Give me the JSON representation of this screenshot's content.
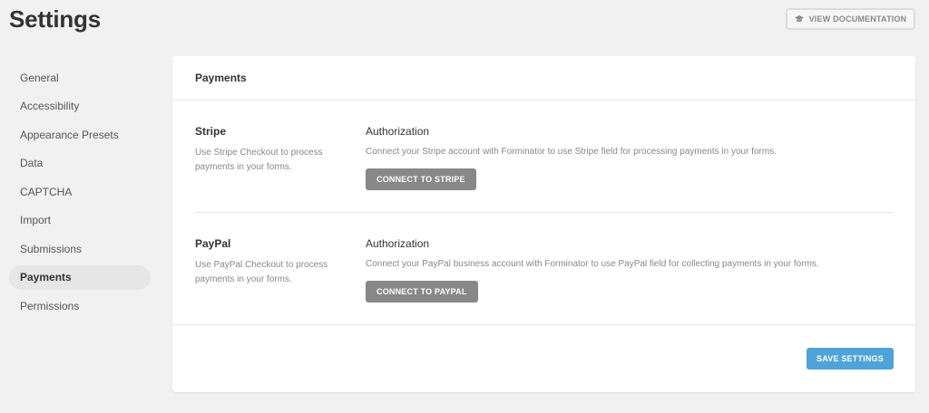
{
  "page": {
    "title": "Settings"
  },
  "header": {
    "doc_button_label": "View Documentation",
    "doc_icon": "graduation-cap-icon"
  },
  "sidebar": {
    "items": [
      {
        "label": "General",
        "active": false
      },
      {
        "label": "Accessibility",
        "active": false
      },
      {
        "label": "Appearance Presets",
        "active": false
      },
      {
        "label": "Data",
        "active": false
      },
      {
        "label": "CAPTCHA",
        "active": false
      },
      {
        "label": "Import",
        "active": false
      },
      {
        "label": "Submissions",
        "active": false
      },
      {
        "label": "Payments",
        "active": true
      },
      {
        "label": "Permissions",
        "active": false
      }
    ]
  },
  "panel": {
    "title": "Payments",
    "sections": [
      {
        "name": "Stripe",
        "description": "Use Stripe Checkout to process payments in your forms.",
        "auth_title": "Authorization",
        "auth_description": "Connect your Stripe account with Forminator to use Stripe field for processing payments in your forms.",
        "button_label": "Connect to Stripe"
      },
      {
        "name": "PayPal",
        "description": "Use PayPal Checkout to process payments in your forms.",
        "auth_title": "Authorization",
        "auth_description": "Connect your PayPal business account with Forminator to use PayPal field for collecting payments in your forms.",
        "button_label": "Connect to PayPal"
      }
    ],
    "save_label": "Save Settings"
  },
  "colors": {
    "accent": "#4ea3d8",
    "button_gray": "#888888",
    "background": "#f1f1f1"
  }
}
